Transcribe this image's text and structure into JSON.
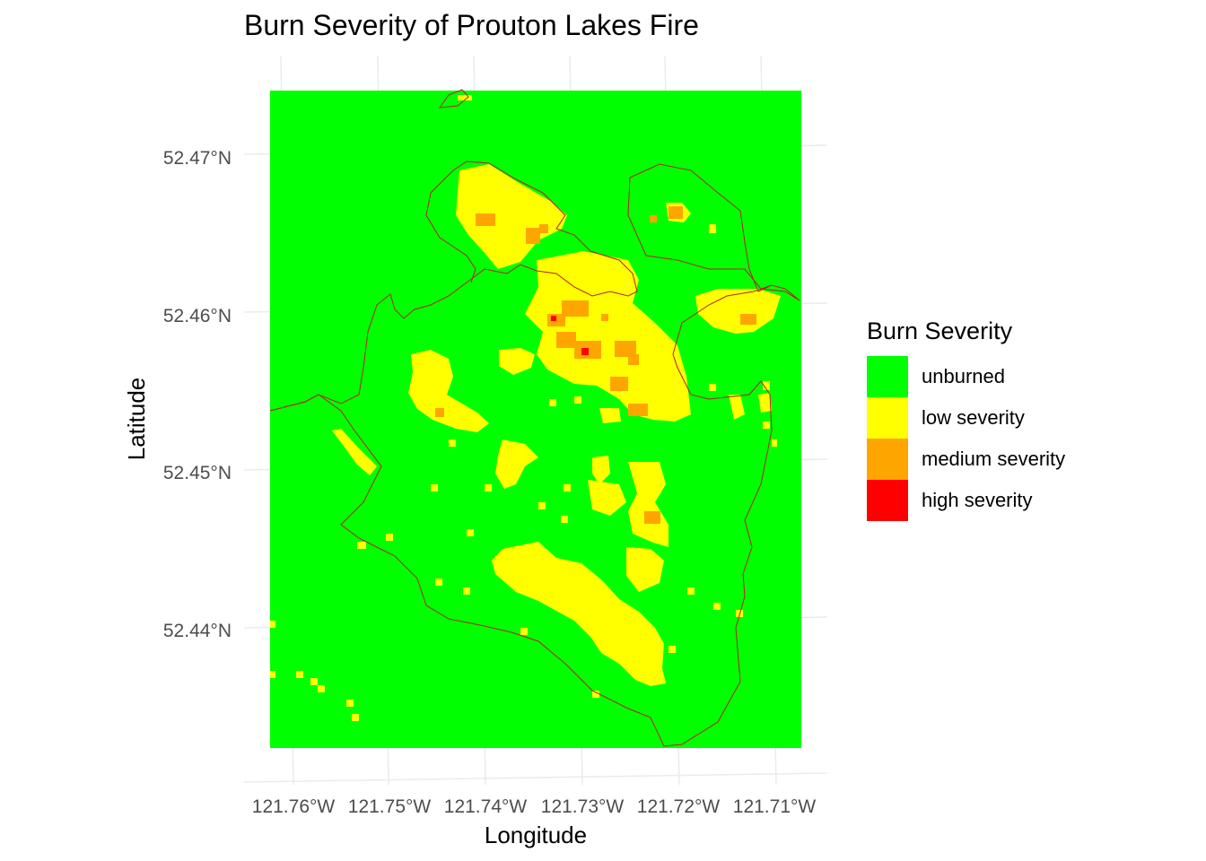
{
  "title": "Burn Severity of Prouton Lakes Fire",
  "x_axis": {
    "label": "Longitude",
    "ticks": [
      "121.76°W",
      "121.75°W",
      "121.74°W",
      "121.73°W",
      "121.72°W",
      "121.71°W"
    ]
  },
  "y_axis": {
    "label": "Latitude",
    "ticks": [
      "52.47°N",
      "52.46°N",
      "52.45°N",
      "52.44°N"
    ]
  },
  "legend": {
    "title": "Burn Severity",
    "items": [
      {
        "label": "unburned",
        "color": "#00ff00"
      },
      {
        "label": "low severity",
        "color": "#ffff00"
      },
      {
        "label": "medium severity",
        "color": "#ffa500"
      },
      {
        "label": "high severity",
        "color": "#ff0000"
      }
    ]
  },
  "colors": {
    "perimeter": "#b22222",
    "gridline": "#ebebeb",
    "background": "#ffffff"
  }
}
